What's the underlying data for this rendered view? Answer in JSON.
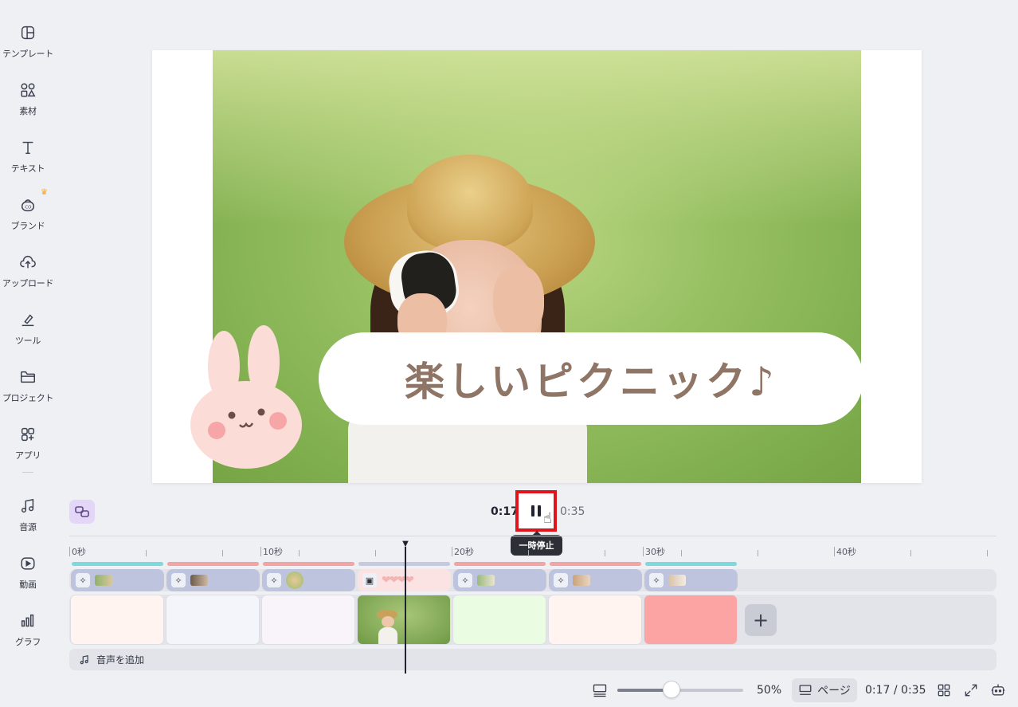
{
  "sidebar": {
    "items": [
      {
        "label": "テンプレート",
        "icon": "template-icon"
      },
      {
        "label": "素材",
        "icon": "elements-icon"
      },
      {
        "label": "テキスト",
        "icon": "text-icon"
      },
      {
        "label": "ブランド",
        "icon": "brand-icon"
      },
      {
        "label": "アップロード",
        "icon": "upload-icon"
      },
      {
        "label": "ツール",
        "icon": "tools-icon"
      },
      {
        "label": "プロジェクト",
        "icon": "folder-icon"
      },
      {
        "label": "アプリ",
        "icon": "apps-icon"
      },
      {
        "label": "音源",
        "icon": "music-icon"
      },
      {
        "label": "動画",
        "icon": "video-icon"
      },
      {
        "label": "グラフ",
        "icon": "chart-icon"
      }
    ]
  },
  "canvas": {
    "title_text": "楽しいピクニック♪"
  },
  "playback": {
    "current_time": "0:17",
    "total_time": "0:35",
    "pause_tooltip": "一時停止"
  },
  "timeline": {
    "ruler_labels": [
      "0秒",
      "10秒",
      "20秒",
      "30秒",
      "40秒"
    ],
    "add_audio_label": "音声を追加",
    "page_colors": [
      "#fff4f0",
      "#f4f5fb",
      "#f8f4fa",
      "photo",
      "#eafce2",
      "#fff4f0",
      "#fca4a4"
    ]
  },
  "bottombar": {
    "zoom": "50%",
    "zoom_fraction": 0.43,
    "page_label": "ページ",
    "time_display": "0:17 / 0:35"
  },
  "colors": {
    "accent_red": "#e0141b",
    "text_brown": "#8f7565",
    "chip": "#bfc4de"
  }
}
